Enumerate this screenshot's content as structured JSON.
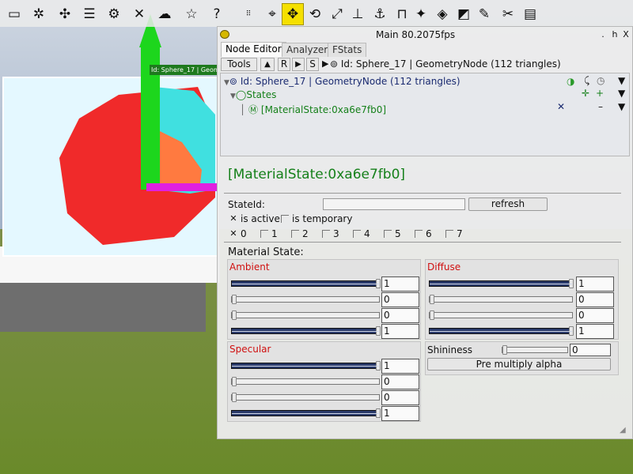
{
  "toolbar": {
    "icons": [
      "folder-icon",
      "palm-tree-icon",
      "puzzle-icon",
      "list-icon",
      "gear-icon",
      "tools-icon",
      "weather-icon",
      "star-icon",
      "help-icon",
      "numpad-icon",
      "camera-icon",
      "move-icon",
      "rotate-icon",
      "scale-icon",
      "align-icon",
      "anchor-icon",
      "measure-icon",
      "pivot-icon",
      "tag-icon",
      "ruler-icon",
      "draw-icon",
      "cut-icon",
      "notes-icon"
    ],
    "active": "move-icon"
  },
  "scene_tooltip": "Id: Sphere_17 | Geom",
  "window": {
    "title": "Main 80.2075fps",
    "buttons": [
      ".",
      "h",
      "X"
    ]
  },
  "tabs": [
    {
      "label": "Node Editor",
      "selected": true
    },
    {
      "label": "Analyzer",
      "selected": false
    },
    {
      "label": "FStats",
      "selected": false
    }
  ],
  "tools_bar": {
    "tools_label": "Tools",
    "up_label": "▲",
    "r_label": "R",
    "play_label": "▶",
    "s_label": "S",
    "path": "Id: Sphere_17 | GeometryNode (112 triangles)"
  },
  "tree": {
    "root": "Id: Sphere_17 | GeometryNode (112 triangles)",
    "states": "States",
    "material": "[MaterialState:0xa6e7fb0]"
  },
  "detail": {
    "title": "[MaterialState:0xa6e7fb0]",
    "stateid_label": "StateId:",
    "refresh_label": "refresh",
    "is_active_label": "is active",
    "is_temporary_label": "is temporary",
    "flags": [
      {
        "label": "0",
        "checked": true
      },
      {
        "label": "1",
        "checked": false
      },
      {
        "label": "2",
        "checked": false
      },
      {
        "label": "3",
        "checked": false
      },
      {
        "label": "4",
        "checked": false
      },
      {
        "label": "5",
        "checked": false
      },
      {
        "label": "6",
        "checked": false
      },
      {
        "label": "7",
        "checked": false
      }
    ],
    "material_state_label": "Material State:",
    "ambient": {
      "label": "Ambient",
      "values": [
        "1",
        "0",
        "0",
        "1"
      ]
    },
    "diffuse": {
      "label": "Diffuse",
      "values": [
        "1",
        "0",
        "0",
        "1"
      ]
    },
    "specular": {
      "label": "Specular",
      "values": [
        "1",
        "0",
        "0",
        "1"
      ]
    },
    "shininess": {
      "label": "Shininess",
      "value": "0"
    },
    "premultiply_label": "Pre multiply alpha"
  },
  "colors": {
    "accent_green": "#15801a",
    "group_header_red": "#d01010",
    "toolbar_active": "#f5e000"
  }
}
